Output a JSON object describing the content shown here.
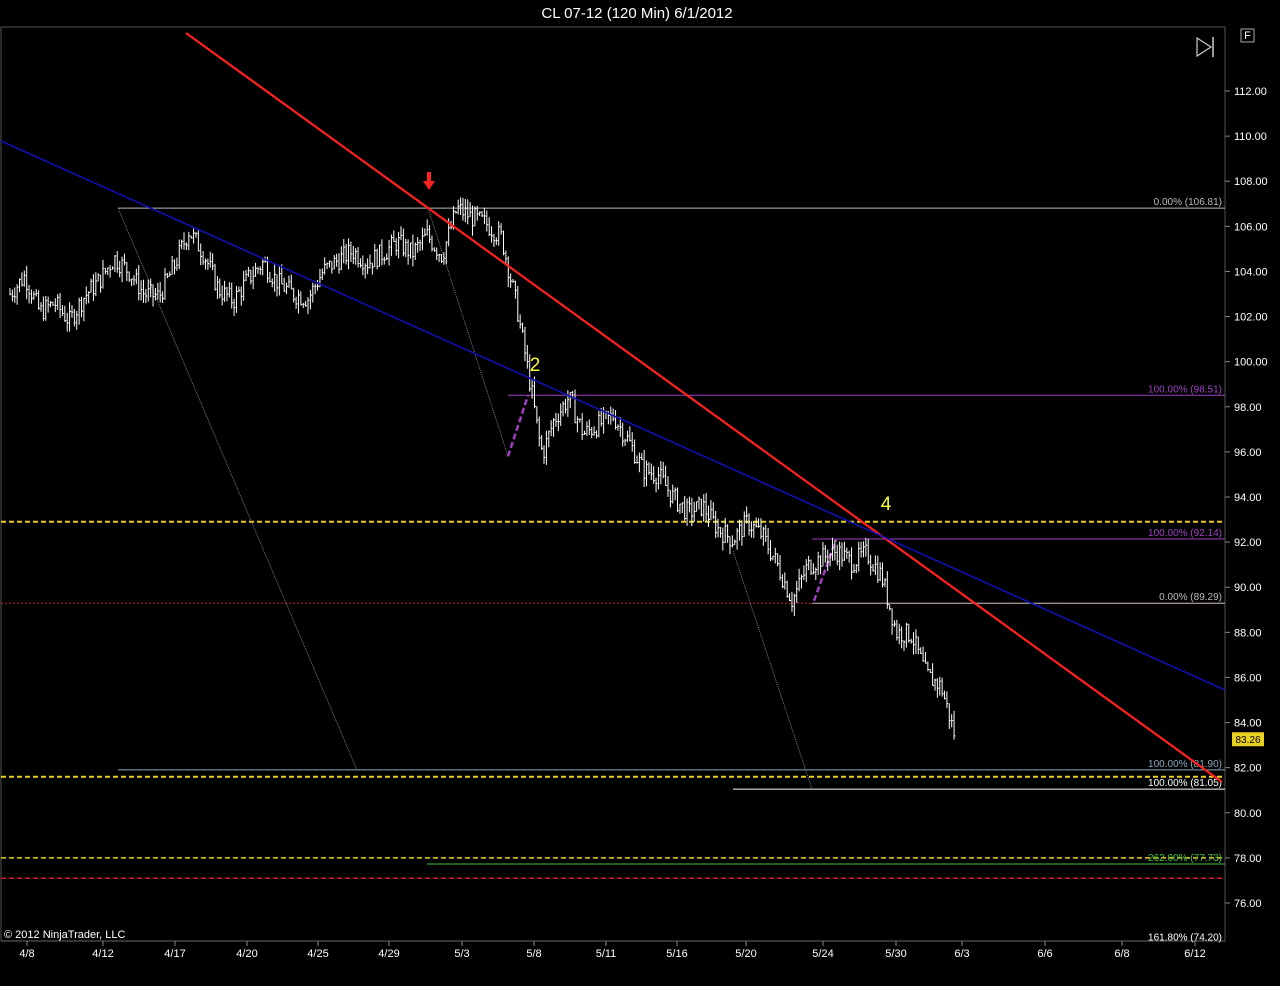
{
  "chart_data": {
    "type": "ohlc",
    "title": "CL 07-12 (120 Min)  6/1/2012",
    "copyright": "© 2012 NinjaTrader, LLC",
    "y_range": [
      74.0,
      113.5
    ],
    "y_ticks": [
      "112.00",
      "110.00",
      "108.00",
      "106.00",
      "104.00",
      "102.00",
      "100.00",
      "98.00",
      "96.00",
      "94.00",
      "92.00",
      "90.00",
      "88.00",
      "86.00",
      "84.00",
      "82.00",
      "80.00",
      "78.00",
      "76.00"
    ],
    "x_ticks": [
      "4/8",
      "4/12",
      "4/17",
      "4/20",
      "4/25",
      "4/29",
      "5/3",
      "5/8",
      "5/11",
      "5/16",
      "5/20",
      "5/24",
      "5/30",
      "6/3",
      "6/6",
      "6/8",
      "6/12"
    ],
    "last_price": "83.26",
    "price_path": [
      [
        0,
        103.0
      ],
      [
        0.02,
        103.8
      ],
      [
        0.04,
        102.2
      ],
      [
        0.06,
        102.6
      ],
      [
        0.08,
        101.8
      ],
      [
        0.1,
        102.9
      ],
      [
        0.12,
        103.6
      ],
      [
        0.14,
        104.6
      ],
      [
        0.16,
        104.0
      ],
      [
        0.18,
        103.0
      ],
      [
        0.2,
        102.9
      ],
      [
        0.22,
        104.2
      ],
      [
        0.24,
        105.8
      ],
      [
        0.26,
        104.8
      ],
      [
        0.28,
        103.2
      ],
      [
        0.3,
        102.7
      ],
      [
        0.32,
        103.7
      ],
      [
        0.34,
        104.4
      ],
      [
        0.36,
        103.5
      ],
      [
        0.38,
        103.0
      ],
      [
        0.4,
        102.8
      ],
      [
        0.42,
        104.0
      ],
      [
        0.44,
        104.5
      ],
      [
        0.46,
        104.9
      ],
      [
        0.48,
        104.4
      ],
      [
        0.5,
        104.8
      ],
      [
        0.52,
        105.3
      ],
      [
        0.54,
        104.8
      ],
      [
        0.56,
        105.6
      ],
      [
        0.58,
        104.7
      ],
      [
        0.6,
        106.8
      ],
      [
        0.62,
        106.4
      ],
      [
        0.64,
        106.1
      ],
      [
        0.66,
        105.5
      ],
      [
        0.68,
        102.5
      ],
      [
        0.7,
        98.7
      ],
      [
        0.71,
        96.6
      ],
      [
        0.715,
        95.9
      ],
      [
        0.73,
        97.4
      ],
      [
        0.75,
        98.4
      ],
      [
        0.77,
        96.8
      ],
      [
        0.79,
        97.2
      ],
      [
        0.81,
        97.6
      ],
      [
        0.83,
        96.5
      ],
      [
        0.85,
        95.2
      ],
      [
        0.87,
        95.0
      ],
      [
        0.89,
        94.0
      ],
      [
        0.91,
        93.3
      ],
      [
        0.93,
        93.6
      ],
      [
        0.95,
        92.6
      ],
      [
        0.97,
        92.1
      ],
      [
        0.99,
        92.9
      ],
      [
        1.01,
        92.3
      ],
      [
        1.03,
        91.0
      ],
      [
        1.05,
        89.4
      ],
      [
        1.07,
        90.9
      ],
      [
        1.09,
        91.3
      ],
      [
        1.11,
        91.6
      ],
      [
        1.13,
        91.1
      ],
      [
        1.15,
        91.5
      ],
      [
        1.17,
        90.5
      ],
      [
        1.19,
        88.0
      ],
      [
        1.21,
        87.9
      ],
      [
        1.23,
        86.1
      ],
      [
        1.25,
        85.6
      ],
      [
        1.27,
        83.2
      ]
    ],
    "trendlines": [
      {
        "name": "red-trendline",
        "color": "#ff2020"
      },
      {
        "name": "blue-trendline",
        "color": "#1010b0"
      }
    ],
    "levels": [
      {
        "label": "0.00% (106.81)",
        "price": 106.81,
        "color": "#bbbbbb"
      },
      {
        "label": "100.00% (98.51)",
        "price": 98.51,
        "color": "#a040c0"
      },
      {
        "label": "100.00% (92.14)",
        "price": 92.14,
        "color": "#a040c0"
      },
      {
        "label": "0.00% (89.29)",
        "price": 89.29,
        "color": "#bbbbbb"
      },
      {
        "label": "100.00% (81.90)",
        "price": 81.9,
        "color": "#8aa8c0"
      },
      {
        "label": "100.00% (81.05)",
        "price": 81.05,
        "color": "#ffffff"
      },
      {
        "label": "262.00% (77.73)",
        "price": 77.73,
        "color": "#40c040"
      },
      {
        "label": "161.80% (74.20)",
        "price": 74.2,
        "color": "#ffffff"
      }
    ],
    "dashed_levels": [
      {
        "price": 92.9,
        "color": "#e8d020"
      },
      {
        "price": 81.6,
        "color": "#e8d020"
      },
      {
        "price": 78.0,
        "color": "#e8d020"
      },
      {
        "price": 89.29,
        "color": "#cc2020"
      },
      {
        "price": 77.1,
        "color": "#cc2020"
      }
    ],
    "annotations": [
      {
        "text": "2",
        "type": "wave"
      },
      {
        "text": "4",
        "type": "wave"
      },
      {
        "text": "F",
        "type": "button"
      }
    ]
  }
}
